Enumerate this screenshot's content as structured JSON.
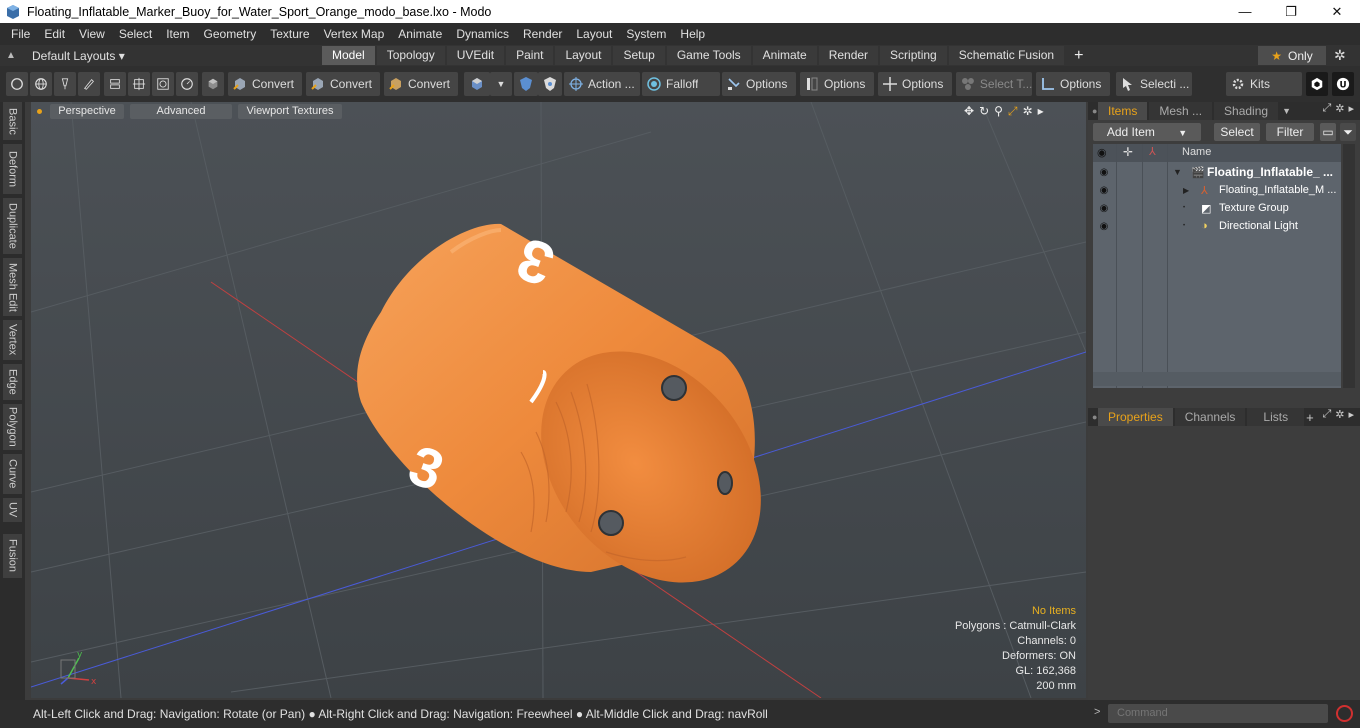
{
  "window": {
    "title": "Floating_Inflatable_Marker_Buoy_for_Water_Sport_Orange_modo_base.lxo - Modo",
    "minimize": "—",
    "maximize": "❐",
    "close": "✕"
  },
  "menu": [
    "File",
    "Edit",
    "View",
    "Select",
    "Item",
    "Geometry",
    "Texture",
    "Vertex Map",
    "Animate",
    "Dynamics",
    "Render",
    "Layout",
    "System",
    "Help"
  ],
  "layoutbar": {
    "default_layouts": "Default Layouts ▾",
    "tabs": [
      "Model",
      "Topology",
      "UVEdit",
      "Paint",
      "Layout",
      "Setup",
      "Game Tools",
      "Animate",
      "Render",
      "Scripting",
      "Schematic Fusion"
    ],
    "active_tab": "Model",
    "plus": "+",
    "only": "Only"
  },
  "toolbar": {
    "convert1": "Convert",
    "convert2": "Convert",
    "convert3": "Convert",
    "action": "Action ...",
    "falloff": "Falloff",
    "options1": "Options",
    "options2": "Options",
    "options3": "Options",
    "select_t": "Select T...",
    "options4": "Options",
    "selecti": "Selecti ...",
    "kits": "Kits"
  },
  "left_tabs": [
    "Basic",
    "Deform",
    "Duplicate",
    "Mesh Edit",
    "Vertex",
    "Edge",
    "Polygon",
    "Curve",
    "UV",
    "Fusion"
  ],
  "viewport": {
    "perspective": "Perspective",
    "advanced": "Advanced",
    "viewport_textures": "Viewport Textures",
    "stats": {
      "no_items": "No Items",
      "polygons": "Polygons : Catmull-Clark",
      "channels": "Channels: 0",
      "deformers": "Deformers: ON",
      "gl": "GL: 162,368",
      "scale": "200 mm"
    },
    "buoy_number": "3"
  },
  "status": "Alt-Left Click and Drag: Navigation: Rotate (or Pan) ● Alt-Right Click and Drag: Navigation: Freewheel ● Alt-Middle Click and Drag: navRoll",
  "items_panel": {
    "tabs": [
      "Items",
      "Mesh ...",
      "Shading"
    ],
    "add_item": "Add Item",
    "select": "Select",
    "filter": "Filter",
    "name_header": "Name",
    "rows": [
      {
        "label": "Floating_Inflatable_ ...",
        "bold": true
      },
      {
        "label": "Floating_Inflatable_M ..."
      },
      {
        "label": "Texture Group"
      },
      {
        "label": "Directional Light"
      }
    ]
  },
  "properties_panel": {
    "tabs": [
      "Properties",
      "Channels",
      "Lists"
    ],
    "plus": "+"
  },
  "command": {
    "placeholder": "Command"
  },
  "colors": {
    "buoy_orange": "#f08a3e",
    "accent": "#e8a21a"
  }
}
